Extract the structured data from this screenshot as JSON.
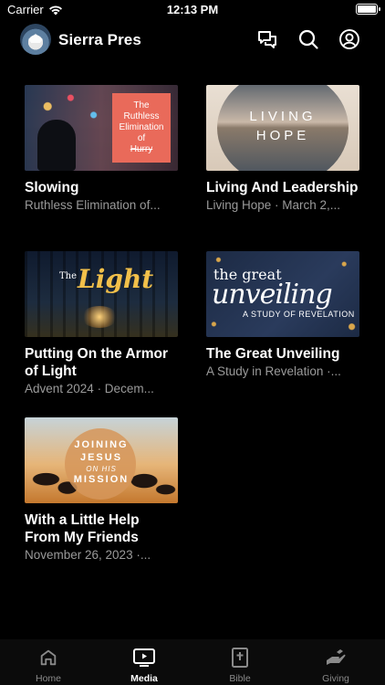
{
  "status_bar": {
    "carrier": "Carrier",
    "time": "12:13 PM"
  },
  "header": {
    "title": "Sierra Pres"
  },
  "items": [
    {
      "title": "Slowing",
      "subtitle": "Ruthless Elimination of...",
      "thumb_text": [
        "The",
        "Ruthless",
        "Elimination",
        "of",
        "Hurry"
      ]
    },
    {
      "title": "Living And Leadership",
      "subtitle": "Living Hope · March 2,...",
      "thumb_text": [
        "LIVING",
        "HOPE"
      ]
    },
    {
      "title": "Putting On the Armor of Light",
      "subtitle": "Advent 2024 · Decem...",
      "thumb_text": [
        "The",
        "Light"
      ]
    },
    {
      "title": "The Great Unveiling",
      "subtitle": "A Study in Revelation ·...",
      "thumb_text": [
        "the great",
        "unveiling",
        "A STUDY OF REVELATION"
      ]
    },
    {
      "title": "With a Little Help From My Friends",
      "subtitle": "November 26, 2023 ·...",
      "thumb_text": [
        "JOINING",
        "JESUS",
        "ON HIS",
        "MISSION"
      ]
    }
  ],
  "tabs": [
    {
      "label": "Home",
      "icon": "home-icon",
      "active": false
    },
    {
      "label": "Media",
      "icon": "play-icon",
      "active": true
    },
    {
      "label": "Bible",
      "icon": "bible-icon",
      "active": false
    },
    {
      "label": "Giving",
      "icon": "giving-icon",
      "active": false
    }
  ],
  "colors": {
    "background": "#000000",
    "subtitle": "#9a9a9a",
    "tab_inactive": "#8a8a8a"
  }
}
